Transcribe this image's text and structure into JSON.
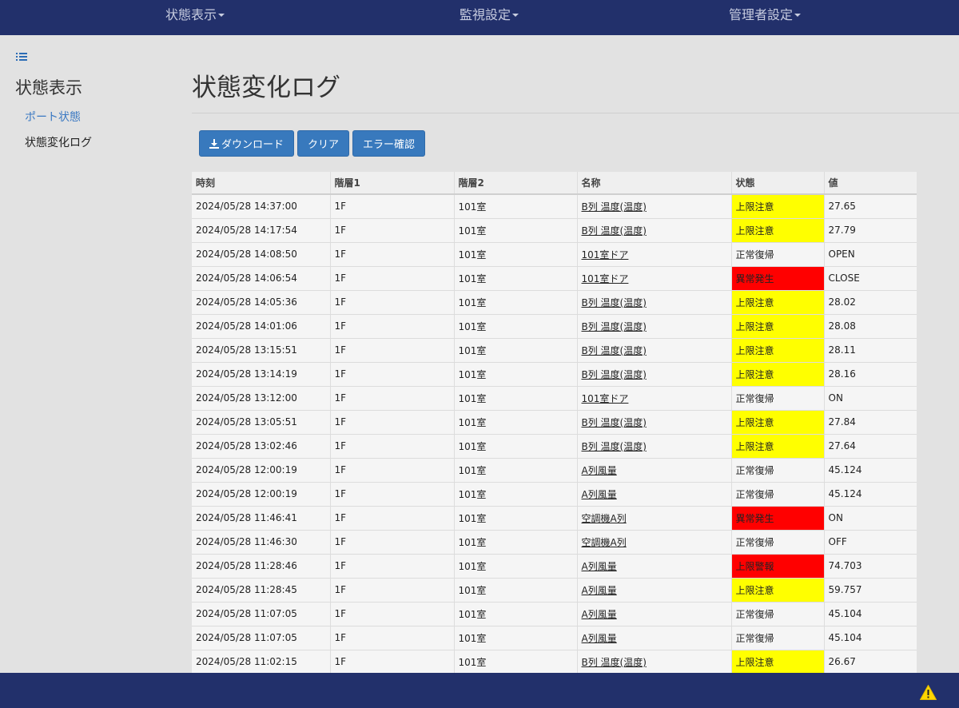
{
  "nav": {
    "status": "状態表示",
    "monitor": "監視設定",
    "admin": "管理者設定"
  },
  "sidebar": {
    "title": "状態表示",
    "items": [
      {
        "label": "ポート状態"
      },
      {
        "label": "状態変化ログ"
      }
    ]
  },
  "page": {
    "title": "状態変化ログ"
  },
  "buttons": {
    "download": "ダウンロード",
    "clear": "クリア",
    "error_check": "エラー確認"
  },
  "table": {
    "headers": [
      "時刻",
      "階層1",
      "階層2",
      "名称",
      "状態",
      "値"
    ],
    "rows": [
      [
        "2024/05/28 14:37:00",
        "1F",
        "101室",
        "B列 温度(温度)",
        "上限注意",
        "27.65"
      ],
      [
        "2024/05/28 14:17:54",
        "1F",
        "101室",
        "B列 温度(温度)",
        "上限注意",
        "27.79"
      ],
      [
        "2024/05/28 14:08:50",
        "1F",
        "101室",
        "101室ドア",
        "正常復帰",
        "OPEN"
      ],
      [
        "2024/05/28 14:06:54",
        "1F",
        "101室",
        "101室ドア",
        "異常発生",
        "CLOSE"
      ],
      [
        "2024/05/28 14:05:36",
        "1F",
        "101室",
        "B列 温度(温度)",
        "上限注意",
        "28.02"
      ],
      [
        "2024/05/28 14:01:06",
        "1F",
        "101室",
        "B列 温度(温度)",
        "上限注意",
        "28.08"
      ],
      [
        "2024/05/28 13:15:51",
        "1F",
        "101室",
        "B列 温度(温度)",
        "上限注意",
        "28.11"
      ],
      [
        "2024/05/28 13:14:19",
        "1F",
        "101室",
        "B列 温度(温度)",
        "上限注意",
        "28.16"
      ],
      [
        "2024/05/28 13:12:00",
        "1F",
        "101室",
        "101室ドア",
        "正常復帰",
        "ON"
      ],
      [
        "2024/05/28 13:05:51",
        "1F",
        "101室",
        "B列 温度(温度)",
        "上限注意",
        "27.84"
      ],
      [
        "2024/05/28 13:02:46",
        "1F",
        "101室",
        "B列 温度(温度)",
        "上限注意",
        "27.64"
      ],
      [
        "2024/05/28 12:00:19",
        "1F",
        "101室",
        "A列風量",
        "正常復帰",
        "45.124"
      ],
      [
        "2024/05/28 12:00:19",
        "1F",
        "101室",
        "A列風量",
        "正常復帰",
        "45.124"
      ],
      [
        "2024/05/28 11:46:41",
        "1F",
        "101室",
        "空調機A列",
        "異常発生",
        "ON"
      ],
      [
        "2024/05/28 11:46:30",
        "1F",
        "101室",
        "空調機A列",
        "正常復帰",
        "OFF"
      ],
      [
        "2024/05/28 11:28:46",
        "1F",
        "101室",
        "A列風量",
        "上限警報",
        "74.703"
      ],
      [
        "2024/05/28 11:28:45",
        "1F",
        "101室",
        "A列風量",
        "上限注意",
        "59.757"
      ],
      [
        "2024/05/28 11:07:05",
        "1F",
        "101室",
        "A列風量",
        "正常復帰",
        "45.104"
      ],
      [
        "2024/05/28 11:07:05",
        "1F",
        "101室",
        "A列風量",
        "正常復帰",
        "45.104"
      ],
      [
        "2024/05/28 11:02:15",
        "1F",
        "101室",
        "B列 温度(温度)",
        "上限注意",
        "26.67"
      ]
    ]
  },
  "status_colors": {
    "上限注意": "#ffff00",
    "異常発生": "#ff0000",
    "上限警報": "#ff0000",
    "正常復帰": ""
  },
  "colors": {
    "navbar": "#22306b",
    "button": "#3879bd",
    "link": "#3a78c2"
  },
  "icons": {
    "sidebar_toggle": "list-icon",
    "download": "download-icon",
    "footer": "warning-icon"
  }
}
